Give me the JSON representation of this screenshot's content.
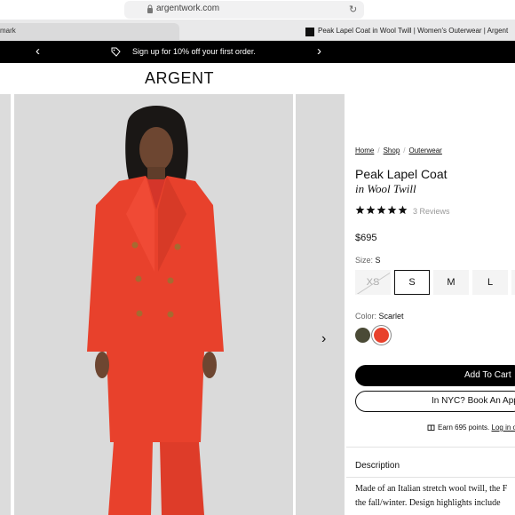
{
  "browser": {
    "url": "argentwork.com",
    "bookmark_tab_label": "mark",
    "active_tab_title": "Peak Lapel Coat in Wool Twill | Women's Outerwear | Argent"
  },
  "promo": {
    "text": "Sign up for 10% off your first order."
  },
  "header": {
    "brand": "ARGENT"
  },
  "breadcrumbs": [
    "Home",
    "Shop",
    "Outerwear"
  ],
  "product": {
    "name": "Peak Lapel Coat",
    "subtitle": "in Wool Twill",
    "rating": 5,
    "reviews": "3 Reviews",
    "price": "$695",
    "size_label": "Size:",
    "selected_size": "S",
    "sizes": [
      {
        "label": "XS",
        "available": false
      },
      {
        "label": "S",
        "available": true,
        "selected": true
      },
      {
        "label": "M",
        "available": true
      },
      {
        "label": "L",
        "available": true
      }
    ],
    "color_label": "Color:",
    "selected_color": "Scarlet",
    "colors": [
      {
        "name": "olive",
        "hex": "#4a4a36"
      },
      {
        "name": "Scarlet",
        "hex": "#e8412c",
        "selected": true
      }
    ],
    "add_to_cart": "Add To Cart",
    "appointment": "In NYC? Book An Appo",
    "points_text": "Earn 695 points.",
    "points_link": "Log in o",
    "description_heading": "Description",
    "description_line1": "Made of an Italian stretch wool twill, the F",
    "description_line2": "the fall/winter. Design highlights include"
  },
  "colors": {
    "coat": "#e8412c",
    "accent_black": "#000000",
    "gallery_bg": "#dadada"
  }
}
